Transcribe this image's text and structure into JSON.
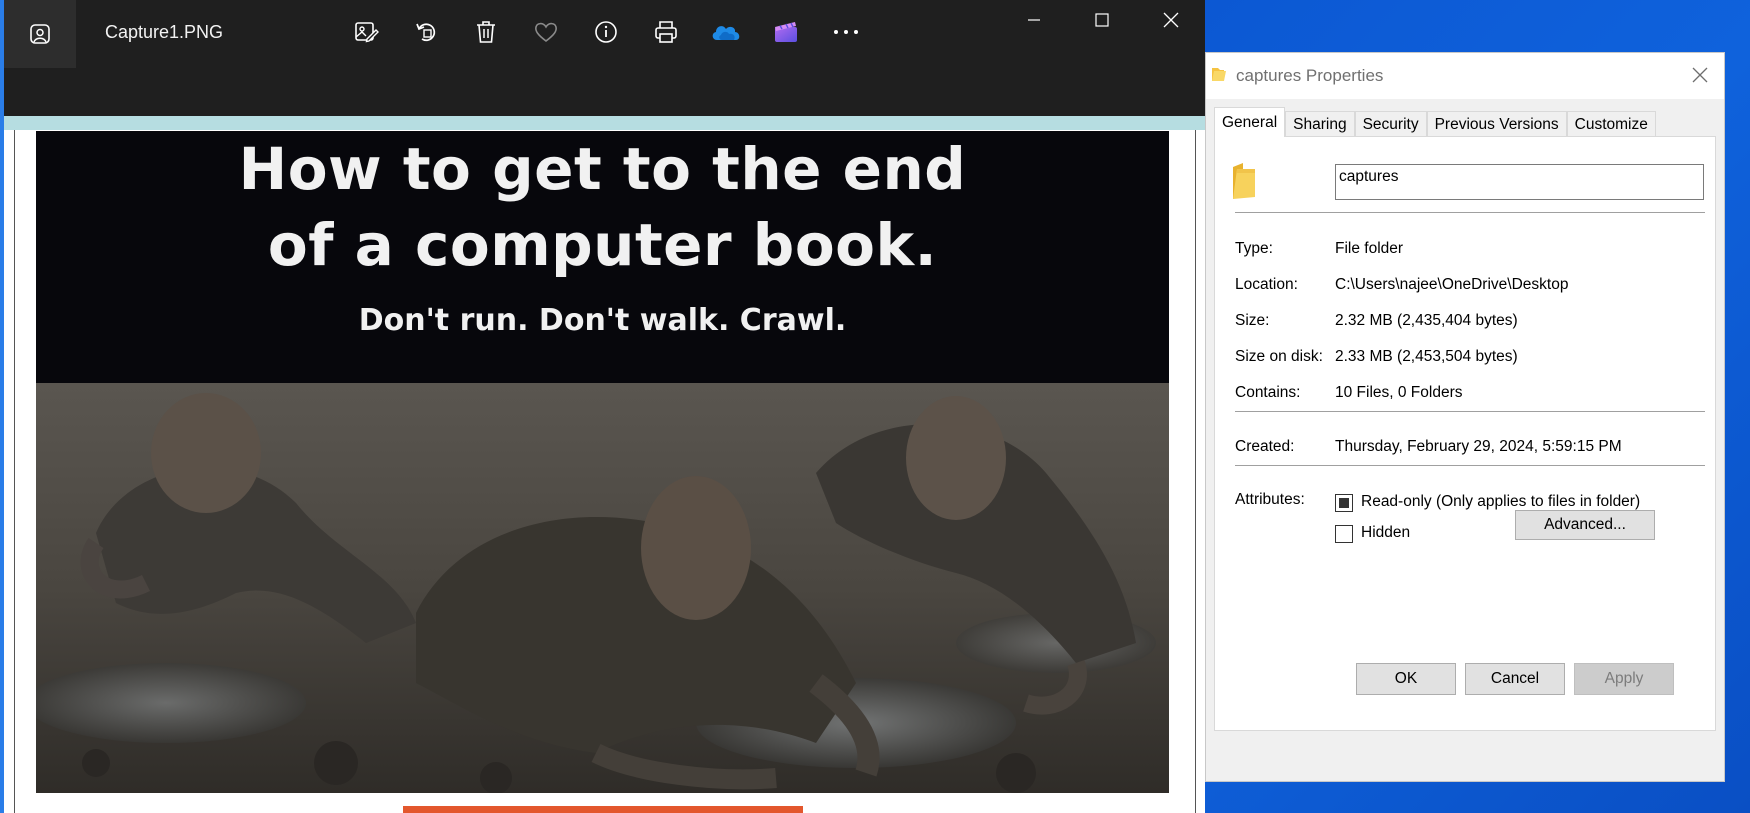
{
  "photos_app": {
    "file_name": "Capture1.PNG",
    "toolbar": [
      {
        "name": "edit-image-icon"
      },
      {
        "name": "rotate-icon"
      },
      {
        "name": "delete-icon"
      },
      {
        "name": "favorite-heart-icon"
      },
      {
        "name": "info-icon"
      },
      {
        "name": "print-icon"
      },
      {
        "name": "onedrive-cloud-icon"
      },
      {
        "name": "clipchamp-icon"
      },
      {
        "name": "more-options-icon"
      }
    ],
    "colors": {
      "titlebar": "#1f1f1f",
      "strip": "#b6dde1",
      "accent_bar": "#e3572d"
    }
  },
  "meme": {
    "line1": "How to get to the end",
    "line2": "of a computer book.",
    "line3": "Don't run. Don't walk. Crawl."
  },
  "properties": {
    "title": "captures Properties",
    "tabs": [
      "General",
      "Sharing",
      "Security",
      "Previous Versions",
      "Customize"
    ],
    "active_tab": "General",
    "folder_name": "captures",
    "rows": [
      {
        "label": "Type:",
        "value": "File folder"
      },
      {
        "label": "Location:",
        "value": "C:\\Users\\najee\\OneDrive\\Desktop"
      },
      {
        "label": "Size:",
        "value": "2.32 MB (2,435,404 bytes)"
      },
      {
        "label": "Size on disk:",
        "value": "2.33 MB (2,453,504 bytes)"
      },
      {
        "label": "Contains:",
        "value": "10 Files, 0 Folders"
      }
    ],
    "created_label": "Created:",
    "created_value": "Thursday, February 29, 2024, 5:59:15 PM",
    "attributes_label": "Attributes:",
    "readonly_label": "Read-only (Only applies to files in folder)",
    "readonly_state": "indeterminate",
    "hidden_label": "Hidden",
    "hidden_checked": false,
    "advanced_label": "Advanced...",
    "buttons": {
      "ok": "OK",
      "cancel": "Cancel",
      "apply": "Apply"
    }
  }
}
